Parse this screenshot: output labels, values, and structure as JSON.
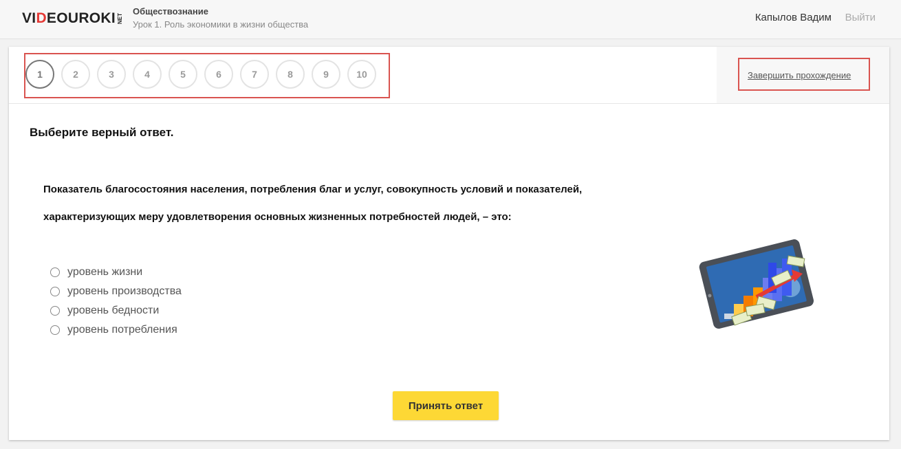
{
  "header": {
    "logo": {
      "part1": "VI",
      "part2": "D",
      "part3": "EOUROKI",
      "net": "NET"
    },
    "course_title": "Обществознание",
    "course_subtitle": "Урок 1. Роль экономики в жизни общества",
    "user_name": "Капылов Вадим",
    "logout_label": "Выйти"
  },
  "test": {
    "questions": [
      "1",
      "2",
      "3",
      "4",
      "5",
      "6",
      "7",
      "8",
      "9",
      "10"
    ],
    "active_question": "1",
    "finish_label": "Завершить прохождение"
  },
  "question": {
    "instruction": "Выберите верный ответ.",
    "text": "Показатель благосостояния населения, потребления благ и услуг, совокупность условий и показателей, характеризующих меру удовлетворения основных жизненных потребностей людей, – это:",
    "options": [
      "уровень жизни",
      "уровень производства",
      "уровень бедности",
      "уровень потребления"
    ]
  },
  "actions": {
    "accept_label": "Принять ответ"
  },
  "colors": {
    "accent": "#fdd835",
    "highlight": "#d9534f",
    "logo_red": "#e53935"
  }
}
